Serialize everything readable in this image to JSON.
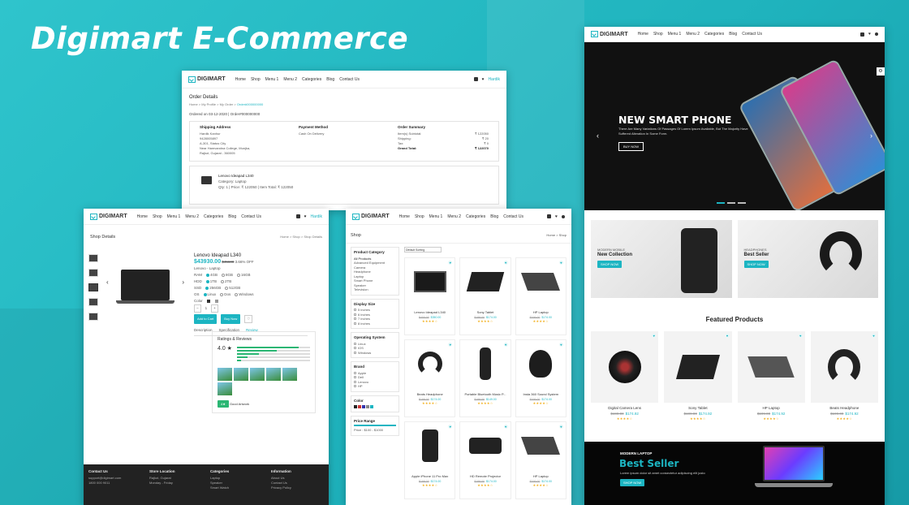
{
  "headline": "Digimart E-Commerce",
  "nav": {
    "logo": "DIGIMART",
    "items": [
      "Home",
      "Shop",
      "Menu 1",
      "Menu 2",
      "Categories",
      "Blog",
      "Contact Us"
    ],
    "user": "Hardik"
  },
  "order": {
    "title": "Order Details",
    "breadcrumb": [
      "Home",
      "My Profile",
      "My Order",
      "Order#000000000"
    ],
    "meta": "Ordered on 03-12-2020 | Order#000000000",
    "shipping_title": "Shipping Address",
    "shipping_lines": [
      "Hardik Kanhur",
      "9428005897",
      "A-301, Status City",
      "Near Hamvandna College, Munjka,",
      "Rajkot, Gujarat - 360005"
    ],
    "payment_title": "Payment Method",
    "payment_value": "Cash On Delivery",
    "summary_title": "Order Summary",
    "summary": [
      {
        "label": "Item(s) Subtotal:",
        "value": "₹ 122050"
      },
      {
        "label": "Shipping:",
        "value": "₹ 20"
      },
      {
        "label": "Tax:",
        "value": "₹ 0"
      },
      {
        "label": "Grand Total:",
        "value": "₹ 122070"
      }
    ],
    "item_name": "Lenovo Ideapad L340",
    "item_category": "Category: Laptop",
    "item_line": "Qty: 1 | Price: ₹ 122050 | Item Total: ₹ 122050"
  },
  "details": {
    "page_title": "Shop Details",
    "breadcrumb": "Home > Shop > Shop Details",
    "product": "Lenovo Ideapad L340",
    "price": "$43930.00",
    "old_price": "$45600",
    "off": "3.66% OFF",
    "subcat": "Lenovo - Laptop",
    "ram_label": "RAM",
    "ram_opts": [
      "4GB",
      "8GB",
      "16GB"
    ],
    "hdd_label": "HDD",
    "hdd_opts": [
      "1TB",
      "2TB"
    ],
    "ssd_label": "SSD",
    "ssd_opts": [
      "256GB",
      "512GB"
    ],
    "os_label": "OS",
    "os_opts": [
      "Linux",
      "Dos",
      "Windows"
    ],
    "color_label": "Color",
    "qty": "1",
    "add_cart": "Add to Cart",
    "buy_now": "Buy Now",
    "tabs": [
      "Description",
      "Specification",
      "Review"
    ],
    "reviews_title": "Ratings & Reviews",
    "rating": "4.0 ★",
    "reviewer": "Good Artwork",
    "footer": [
      {
        "title": "Contact Us",
        "lines": [
          "support@digimart.com",
          "1800 000 9011"
        ]
      },
      {
        "title": "Store Location",
        "lines": [
          "Rajkot, Gujarat",
          "Monday - Friday"
        ]
      },
      {
        "title": "Categories",
        "lines": [
          "Laptop",
          "Speaker",
          "Smart Watch"
        ]
      },
      {
        "title": "Information",
        "lines": [
          "About Us",
          "Contact Us",
          "Privacy Policy"
        ]
      }
    ]
  },
  "shop": {
    "page_title": "Shop",
    "breadcrumb": "Home > Shop",
    "sort": "Default Sorting",
    "filters": [
      {
        "title": "Product Category",
        "items": [
          "All Products",
          "Advanced Equipment",
          "Camera",
          "Headphone",
          "Laptop",
          "Smart Phone",
          "Speaker",
          "Television"
        ]
      },
      {
        "title": "Display Size",
        "items": [
          "5 inches",
          "6 inches",
          "7 inches",
          "8 inches"
        ]
      },
      {
        "title": "Operating System",
        "items": [
          "Linux",
          "IOS",
          "Windows"
        ]
      },
      {
        "title": "Brand",
        "items": [
          "Apple",
          "Dell",
          "Lenovo",
          "HP"
        ]
      },
      {
        "title": "Color",
        "items": []
      },
      {
        "title": "Price Range",
        "items": [
          "Price : $100 - $1000"
        ]
      }
    ],
    "products": [
      {
        "name": "Lenovo Ideapad L340",
        "old": "$400.00",
        "price": "$350.00"
      },
      {
        "name": "Sony Tablet",
        "old": "$199.00",
        "price": "$174.00"
      },
      {
        "name": "HP Laptop",
        "old": "$199.00",
        "price": "$174.00"
      },
      {
        "name": "Beats Headphone",
        "old": "$199.00",
        "price": "$174.00"
      },
      {
        "name": "Portable Bluetooth Music P...",
        "old": "$199.00",
        "price": "$149.00"
      },
      {
        "name": "Insta 360 Sound System",
        "old": "$199.00",
        "price": "$174.00"
      },
      {
        "name": "Apple iPhone 11 Pro Max",
        "old": "$199.00",
        "price": "$174.00"
      },
      {
        "name": "HD Remote Projector",
        "old": "$199.00",
        "price": "$174.00"
      },
      {
        "name": "HP Laptop",
        "old": "$199.00",
        "price": "$174.00"
      }
    ]
  },
  "home": {
    "hero_title": "NEW SMART PHONE",
    "hero_text": "There Are Many Variations Of Passages Of Lorem Ipsum Available, But The Majority Have Suffered Alteration In Some Form.",
    "hero_btn": "BUY NOW",
    "banners": [
      {
        "kicker": "MODERN MOBILE",
        "title": "New Collection",
        "btn": "SHOP NOW"
      },
      {
        "kicker": "HEADPHONES",
        "title": "Best Seller",
        "btn": "SHOP NOW"
      }
    ],
    "featured_title": "Featured Products",
    "featured": [
      {
        "name": "Digital Camera Lens",
        "old": "$199.00",
        "price": "$174.92"
      },
      {
        "name": "Sony Tablet",
        "old": "$199.00",
        "price": "$174.92"
      },
      {
        "name": "HP Laptop",
        "old": "$199.00",
        "price": "$174.92"
      },
      {
        "name": "Beats Headphone",
        "old": "$199.00",
        "price": "$174.92"
      }
    ],
    "bs_kicker": "MODERN LAPTOP",
    "bs_title": "Best Seller",
    "bs_text": "Lorem ipsum dolor sit amet consectetur adipiscing elit justo",
    "bs_btn": "SHOP NOW"
  }
}
